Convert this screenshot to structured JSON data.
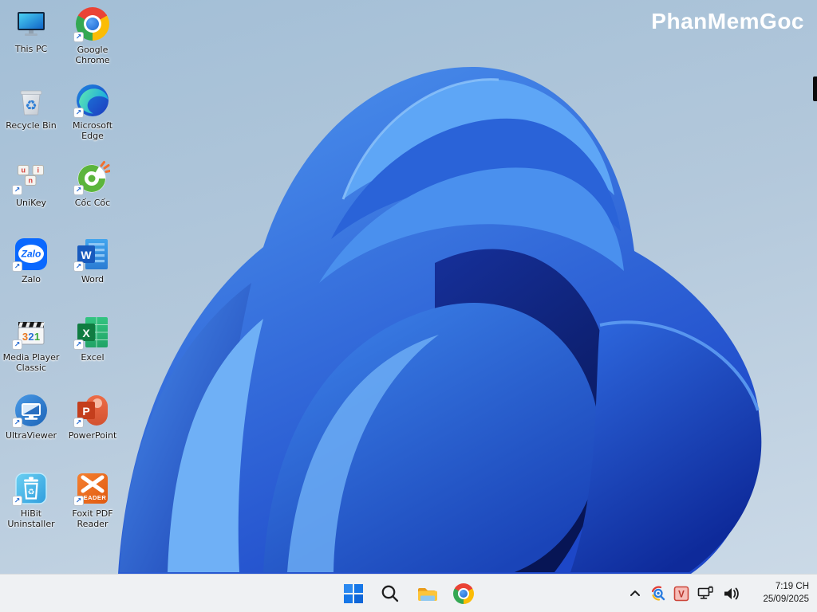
{
  "watermark": "PhanMemGoc",
  "wallpaper": {
    "name": "windows-11-bloom",
    "background_top": "#a2bed6",
    "background_bottom": "#cddbe8",
    "bloom_light": "#6fb1f7",
    "bloom_mid": "#2a63d8",
    "bloom_dark": "#0a1c74"
  },
  "desktop": {
    "shortcut_arrow": "↗",
    "icons": [
      {
        "name": "this-pc",
        "label": "This PC",
        "shortcut": false
      },
      {
        "name": "google-chrome",
        "label": "Google Chrome",
        "shortcut": true
      },
      {
        "name": "recycle-bin",
        "label": "Recycle Bin",
        "shortcut": false,
        "glyph": "♻"
      },
      {
        "name": "microsoft-edge",
        "label": "Microsoft Edge",
        "shortcut": true
      },
      {
        "name": "unikey",
        "label": "UniKey",
        "shortcut": true,
        "glyphs": {
          "k1": "u",
          "k2": "i",
          "k3": "n"
        }
      },
      {
        "name": "coc-coc",
        "label": "Cốc Cốc",
        "shortcut": true
      },
      {
        "name": "zalo",
        "label": "Zalo",
        "shortcut": true,
        "glyph": "Zalo"
      },
      {
        "name": "word",
        "label": "Word",
        "shortcut": true,
        "glyph": "W"
      },
      {
        "name": "media-player-classic",
        "label": "Media Player Classic",
        "shortcut": true,
        "glyphs": {
          "g1": "3",
          "g2": "2",
          "g3": "1"
        }
      },
      {
        "name": "excel",
        "label": "Excel",
        "shortcut": true,
        "glyph": "X"
      },
      {
        "name": "ultraviewer",
        "label": "UltraViewer",
        "shortcut": true
      },
      {
        "name": "powerpoint",
        "label": "PowerPoint",
        "shortcut": true,
        "glyph": "P"
      },
      {
        "name": "hibit-uninstaller",
        "label": "HiBit Uninstaller",
        "shortcut": true,
        "glyph": "♻"
      },
      {
        "name": "foxit-pdf-reader",
        "label": "Foxit PDF Reader",
        "shortcut": true,
        "glyph": "READER"
      }
    ]
  },
  "taskbar": {
    "buttons": [
      {
        "icon": "windows-start"
      },
      {
        "icon": "search"
      },
      {
        "icon": "file-explorer"
      },
      {
        "icon": "google-chrome"
      }
    ],
    "tray": {
      "icons": [
        "hidden-icons-chevron",
        "scanner-app",
        "v-app",
        "ethernet-network",
        "volume"
      ],
      "v_badge": "V",
      "clock": {
        "time": "7:19 CH",
        "date": "25/09/2025"
      }
    }
  }
}
